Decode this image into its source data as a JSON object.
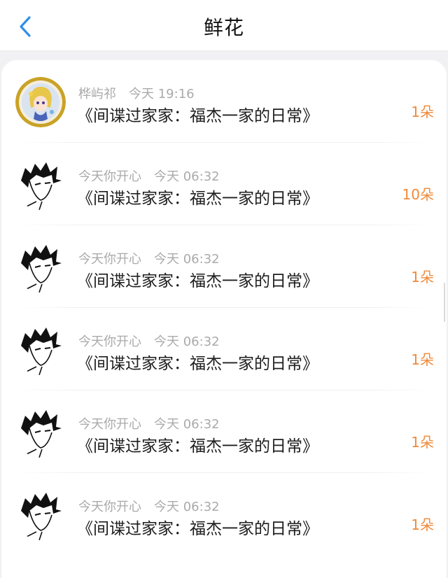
{
  "header": {
    "title": "鲜花",
    "back_icon": "chevron-left-icon",
    "accent_color": "#2f8fe8"
  },
  "records": [
    {
      "user": "桦屿祁",
      "time": "今天 19:16",
      "book": "《间谍过家家：福杰一家的日常》",
      "count": "1朵",
      "avatar": "anime-girl-avatar"
    },
    {
      "user": "今天你开心",
      "time": "今天 06:32",
      "book": "《间谍过家家：福杰一家的日常》",
      "count": "10朵",
      "avatar": "manga-boy-avatar"
    },
    {
      "user": "今天你开心",
      "time": "今天 06:32",
      "book": "《间谍过家家：福杰一家的日常》",
      "count": "1朵",
      "avatar": "manga-boy-avatar"
    },
    {
      "user": "今天你开心",
      "time": "今天 06:32",
      "book": "《间谍过家家：福杰一家的日常》",
      "count": "1朵",
      "avatar": "manga-boy-avatar"
    },
    {
      "user": "今天你开心",
      "time": "今天 06:32",
      "book": "《间谍过家家：福杰一家的日常》",
      "count": "1朵",
      "avatar": "manga-boy-avatar"
    },
    {
      "user": "今天你开心",
      "time": "今天 06:32",
      "book": "《间谍过家家：福杰一家的日常》",
      "count": "1朵",
      "avatar": "manga-boy-avatar"
    }
  ],
  "colors": {
    "count": "#f08a3a",
    "meta": "#aaaaaa",
    "background": "#f1f1f3"
  }
}
